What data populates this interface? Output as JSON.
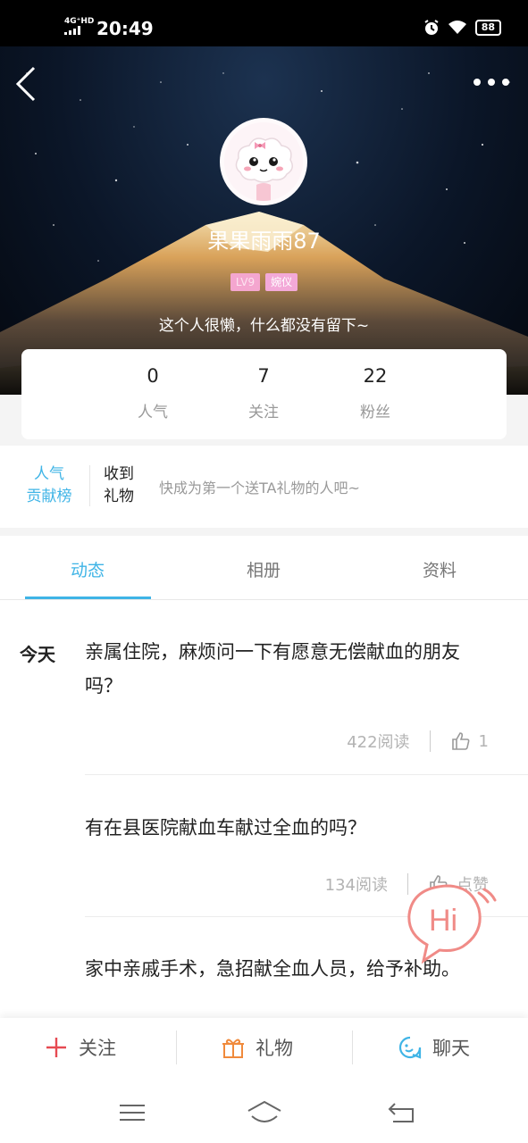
{
  "status_bar": {
    "network": "4G⁺HD",
    "time": "20:49",
    "battery": "88",
    "icons": [
      "signal-icon",
      "alarm-icon",
      "wifi-icon",
      "battery-icon"
    ]
  },
  "profile": {
    "username": "果果雨雨87",
    "level_badge": "LV9",
    "title_badge": "婉仪",
    "bio": "这个人很懒，什么都没有留下~"
  },
  "stats": [
    {
      "value": "0",
      "label": "人气"
    },
    {
      "value": "7",
      "label": "关注"
    },
    {
      "value": "22",
      "label": "粉丝"
    }
  ],
  "gifts": {
    "rank_label_line1": "人气",
    "rank_label_line2": "贡献榜",
    "received_line1": "收到",
    "received_line2": "礼物",
    "hint": "快成为第一个送TA礼物的人吧~"
  },
  "tabs": [
    {
      "label": "动态",
      "active": true
    },
    {
      "label": "相册",
      "active": false
    },
    {
      "label": "资料",
      "active": false
    }
  ],
  "feed": {
    "day": "今天",
    "posts": [
      {
        "text": "亲属住院，麻烦问一下有愿意无偿献血的朋友吗？",
        "reads": "422阅读",
        "likes": "1"
      },
      {
        "text": "有在县医院献血车献过全血的吗？",
        "reads": "134阅读",
        "likes": "点赞"
      },
      {
        "text": "家中亲戚手术，急招献全血人员，给予补助。",
        "reads": "",
        "likes": ""
      }
    ]
  },
  "floating_bubble": {
    "label": "Hi"
  },
  "actions": [
    {
      "label": "关注",
      "icon": "plus-icon",
      "color": "#e64a52"
    },
    {
      "label": "礼物",
      "icon": "gift-icon",
      "color": "#f08a3c"
    },
    {
      "label": "聊天",
      "icon": "chat-icon",
      "color": "#3fb4e6"
    }
  ],
  "colors": {
    "accent": "#3fb4e6",
    "badge_pink": "#f3a9d8",
    "follow_red": "#e64a52",
    "gift_orange": "#f08a3c",
    "bubble_pink": "#f08b87"
  }
}
